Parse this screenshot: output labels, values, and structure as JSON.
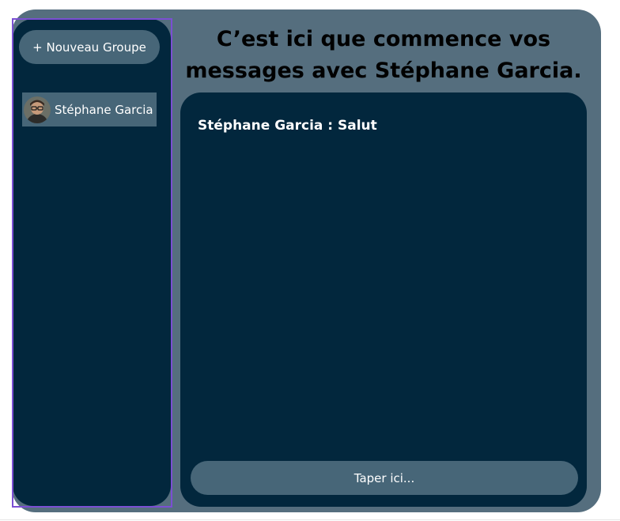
{
  "sidebar": {
    "new_group_label": "+ Nouveau Groupe",
    "contacts": [
      {
        "name": "Stéphane Garcia",
        "avatar_icon": "user-avatar-icon"
      }
    ]
  },
  "conversation": {
    "title": "C’est ici que commence vos messages avec Stéphane Garcia.",
    "messages": [
      {
        "text": "Stéphane Garcia : Salut"
      }
    ]
  },
  "composer": {
    "placeholder": "Taper ici..."
  },
  "colors": {
    "app_background": "#556e7e",
    "panel_background": "#02273d",
    "control_background": "#476678",
    "selection_outline": "#7b4fd3",
    "text_light": "#ffffff"
  }
}
